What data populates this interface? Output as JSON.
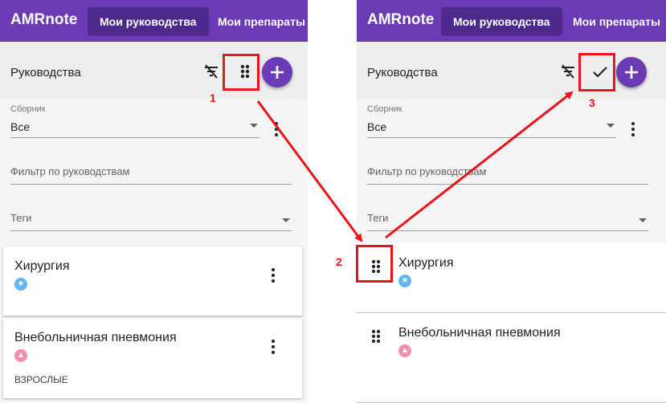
{
  "app_title": "AMRnote",
  "nav": {
    "guides": "Мои руководства",
    "drugs": "Мои препараты"
  },
  "toolbar_title": "Руководства",
  "filters": {
    "collection_label": "Сборник",
    "collection_value": "Все",
    "guide_filter_placeholder": "Фильтр по руководствам",
    "tags_placeholder": "Теги"
  },
  "cards": [
    {
      "title": "Хирургия",
      "subtitle": "",
      "badge_icon": "star-badge-icon"
    },
    {
      "title": "Внебольничная пневмония",
      "subtitle": "ВЗРОСЛЫЕ",
      "badge_icon": "triangle-badge-icon"
    }
  ],
  "annotations": [
    "1",
    "2",
    "3"
  ],
  "colors": {
    "app_bar": "#6a3bb5",
    "active_tab": "#4d2a8c",
    "annotation": "#e8141b",
    "badge_blue": "#64b5f6",
    "badge_pink": "#f48fb1"
  }
}
